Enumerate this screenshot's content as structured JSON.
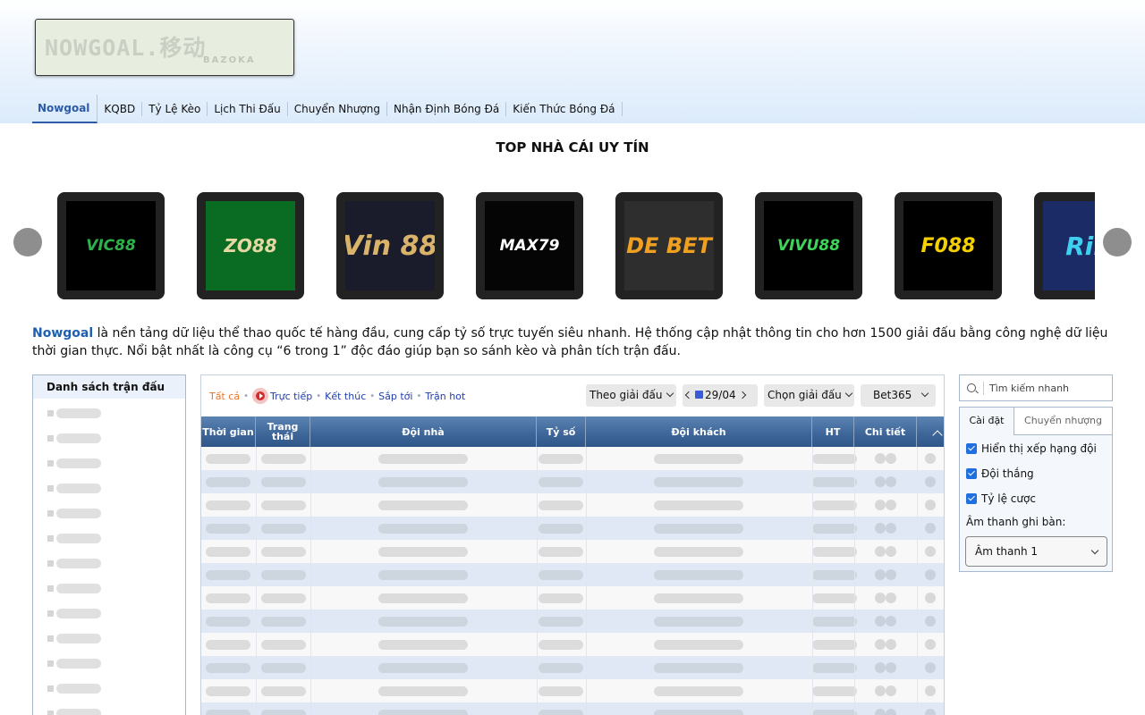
{
  "header": {
    "logo_text": "NOWGOAL.移动",
    "logo_sub": "BAZOKA",
    "nav": [
      "Nowgoal",
      "KQBD",
      "Tỷ Lệ Kèo",
      "Lịch Thi Đấu",
      "Chuyển Nhượng",
      "Nhận Định Bóng Đá",
      "Kiến Thức Bóng Đá"
    ],
    "active_nav": "Nowgoal"
  },
  "top_bookmakers": {
    "title": "TOP NHÀ CÁI UY TÍN",
    "cards": [
      {
        "name": "VIC88",
        "bg": "#000000",
        "color": "#2bb34a"
      },
      {
        "name": "ZO88",
        "bg": "#0a6b23",
        "color": "#e6d8a2"
      },
      {
        "name": "Vin 88",
        "bg": "#1a1c2c",
        "color": "#d9b36a"
      },
      {
        "name": "MAX79",
        "bg": "#050505",
        "color": "#ffffff"
      },
      {
        "name": "DE BET",
        "bg": "#2e2e2e",
        "color": "#f0a020"
      },
      {
        "name": "VIVU88",
        "bg": "#000000",
        "color": "#3dd65a"
      },
      {
        "name": "F088",
        "bg": "#000000",
        "color": "#f5d000"
      },
      {
        "name": "Rik",
        "bg": "#1b2b66",
        "color": "#3fd0f0"
      }
    ]
  },
  "intro": {
    "brand": "Nowgoal",
    "text": " là nền tảng dữ liệu thể thao quốc tế hàng đầu, cung cấp tỷ số trực tuyến siêu nhanh. Hệ thống cập nhật thông tin cho hơn 1500 giải đấu bằng công nghệ dữ liệu thời gian thực. Nổi bật nhất là công cụ “6 trong 1” độc đáo giúp bạn so sánh kèo và phân tích trận đấu."
  },
  "match_list": {
    "title": "Danh sách trận đấu",
    "placeholder_count": 13
  },
  "filters": {
    "all": "Tất cả",
    "live": "Trực tiếp",
    "finished": "Kết thúc",
    "upcoming": "Sắp tới",
    "hot": "Trận hot",
    "sort": "Theo giải đấu",
    "date": "29/04",
    "league": "Chọn giải đấu",
    "bookmaker": "Bet365"
  },
  "table": {
    "headers": {
      "time": "Thời gian",
      "status": "Trang thái",
      "home": "Đội nhà",
      "score": "Tỷ số",
      "away": "Đội khách",
      "ht": "HT",
      "detail": "Chi tiết"
    },
    "placeholder_rows": 12
  },
  "search": {
    "placeholder": "Tìm kiếm nhanh"
  },
  "settings": {
    "tab_settings": "Cài đặt",
    "tab_transfers": "Chuyển nhượng",
    "options": [
      "Hiển thị xếp hạng đội",
      "Đội thắng",
      "Tỷ lệ cược"
    ],
    "sound_label": "Âm thanh ghi bàn:",
    "sound_value": "Âm thanh 1"
  },
  "colors": {
    "accent": "#2d5ba8",
    "header_table": "#3d6597",
    "all_filter": "#e8742b",
    "checkbox": "#1f6fe0"
  }
}
